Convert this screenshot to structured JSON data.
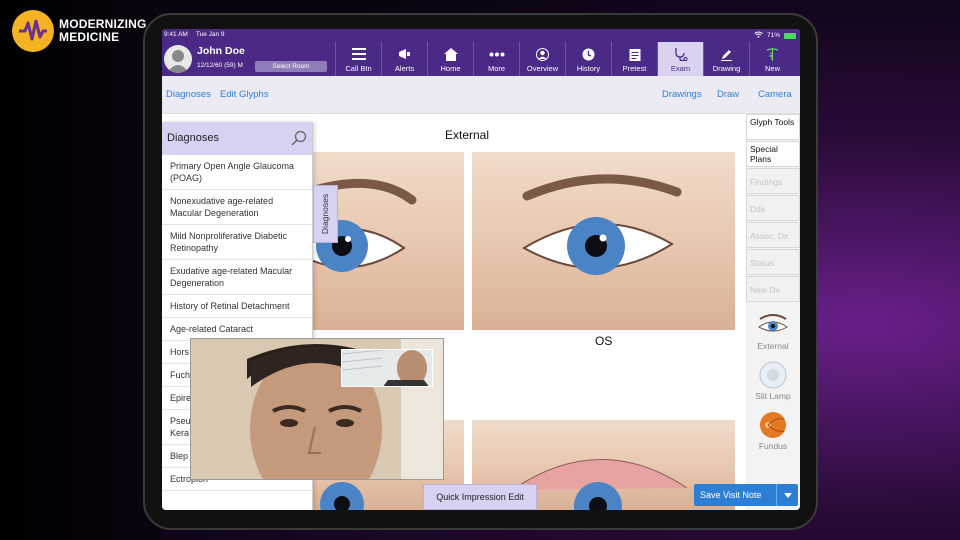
{
  "brand": {
    "line1": "MODERNIZING",
    "line2": "MEDICINE"
  },
  "status_bar": {
    "time": "9:41 AM",
    "date": "Tue Jan 9",
    "battery": "71%"
  },
  "patient": {
    "name": "John Doe",
    "dob": "12/12/60 (59) M",
    "select_room": "Select Room"
  },
  "nav": [
    {
      "label": "Call Btn",
      "icon": "list-icon"
    },
    {
      "label": "Alerts",
      "icon": "megaphone-icon"
    },
    {
      "label": "Home",
      "icon": "home-icon"
    },
    {
      "label": "More",
      "icon": "more-icon"
    },
    {
      "label": "Overview",
      "icon": "person-icon"
    },
    {
      "label": "History",
      "icon": "history-icon"
    },
    {
      "label": "Pretest",
      "icon": "clipboard-icon"
    },
    {
      "label": "Exam",
      "icon": "stethoscope-icon"
    },
    {
      "label": "Drawing",
      "icon": "pen-icon"
    },
    {
      "label": "New",
      "icon": "caduceus-icon"
    }
  ],
  "active_nav": "Exam",
  "subbar": {
    "diagnoses": "Diagnoses",
    "edit_glyphs": "Edit Glyphs",
    "drawings": "Drawings",
    "draw": "Draw",
    "camera": "Camera"
  },
  "right_panel": {
    "buttons": [
      {
        "label": "Glyph Tools",
        "enabled": true
      },
      {
        "label": "Special Plans",
        "enabled": true
      },
      {
        "label": "Findings",
        "enabled": false
      },
      {
        "label": "Ddx",
        "enabled": false
      },
      {
        "label": "Assoc. Dx",
        "enabled": false
      },
      {
        "label": "Status",
        "enabled": false
      },
      {
        "label": "New Dx",
        "enabled": false
      }
    ],
    "views": [
      {
        "label": "External",
        "icon": "eye-external-icon"
      },
      {
        "label": "Slit Lamp",
        "icon": "eye-slitlamp-icon"
      },
      {
        "label": "Fundus",
        "icon": "fundus-icon"
      }
    ]
  },
  "canvas": {
    "title": "External",
    "od_label": "OS"
  },
  "diagnoses_panel": {
    "title": "Diagnoses",
    "tab_label": "Diagnoses",
    "items": [
      "Primary Open Angle Glaucoma (POAG)",
      "Nonexudative age-related Macular Degeneration",
      "Mild Nonproliferative Diabetic Retinopathy",
      "Exudative age-related Macular Degeneration",
      "History of Retinal Detachment",
      "Age-related Cataract",
      "Hors",
      "Fuch",
      "Epire",
      "Pseu Kera",
      "Blep",
      "Ectropion"
    ]
  },
  "footer": {
    "quick_impression": "Quick Impression Edit",
    "save_visit": "Save Visit Note"
  },
  "colors": {
    "header": "#4a2a86",
    "accent": "#2d7fd6",
    "panel": "#d7d1f2"
  }
}
